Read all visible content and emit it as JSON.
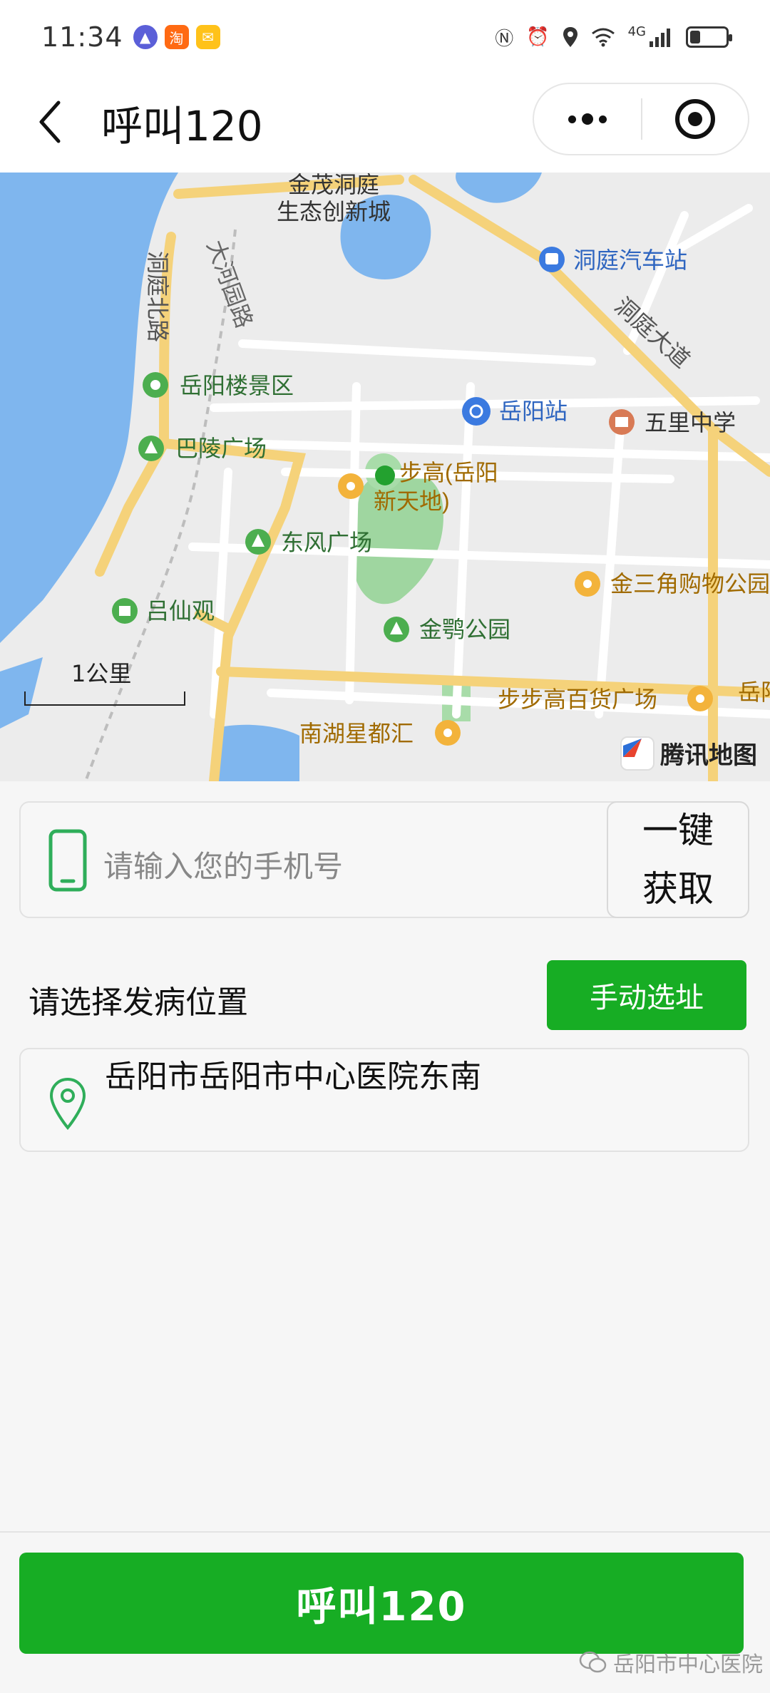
{
  "status_bar": {
    "time": "11:34",
    "notification_icons": [
      "app-icon",
      "taobao-icon",
      "mail-icon"
    ],
    "right_icons": [
      "nfc-icon",
      "alarm-icon",
      "location-icon",
      "wifi-icon",
      "signal-icon",
      "battery-icon"
    ],
    "network": "4G",
    "battery_level": 0.3
  },
  "nav": {
    "title": "呼叫120"
  },
  "map": {
    "labels": {
      "jinmao": "金茂洞庭",
      "shengtai": "生态创新城",
      "dongting_bus": "洞庭汽车站",
      "dongting_north": "洞庭北路",
      "dahe_road": "大河园路",
      "dongting_avenue": "洞庭大道",
      "yueyang_tower": "岳阳楼景区",
      "yueyang_station": "岳阳站",
      "wuli_school": "五里中学",
      "baling_square": "巴陵广场",
      "bubugao1": "步高(岳阳",
      "bubugao2": "新天地)",
      "dongfeng_square": "东风广场",
      "jinsanjiao": "金三角购物公园",
      "lvxianguan": "吕仙观",
      "jinying_park": "金鹗公园",
      "bubugao_dept": "步步高百货广场",
      "yue_edge": "岳阳",
      "nanhu": "南湖星都汇"
    },
    "scale_label": "1公里",
    "brand": "腾讯地图"
  },
  "phone": {
    "placeholder": "请输入您的手机号",
    "get_button": "一键获取"
  },
  "location": {
    "label": "请选择发病位置",
    "manual_button": "手动选址",
    "address": "岳阳市岳阳市中心医院东南"
  },
  "call_button": "呼叫120",
  "watermark": "岳阳市中心医院",
  "colors": {
    "primary_green": "#17ad24",
    "map_water": "#7fb6ee",
    "map_road_major": "#f5d27a"
  }
}
